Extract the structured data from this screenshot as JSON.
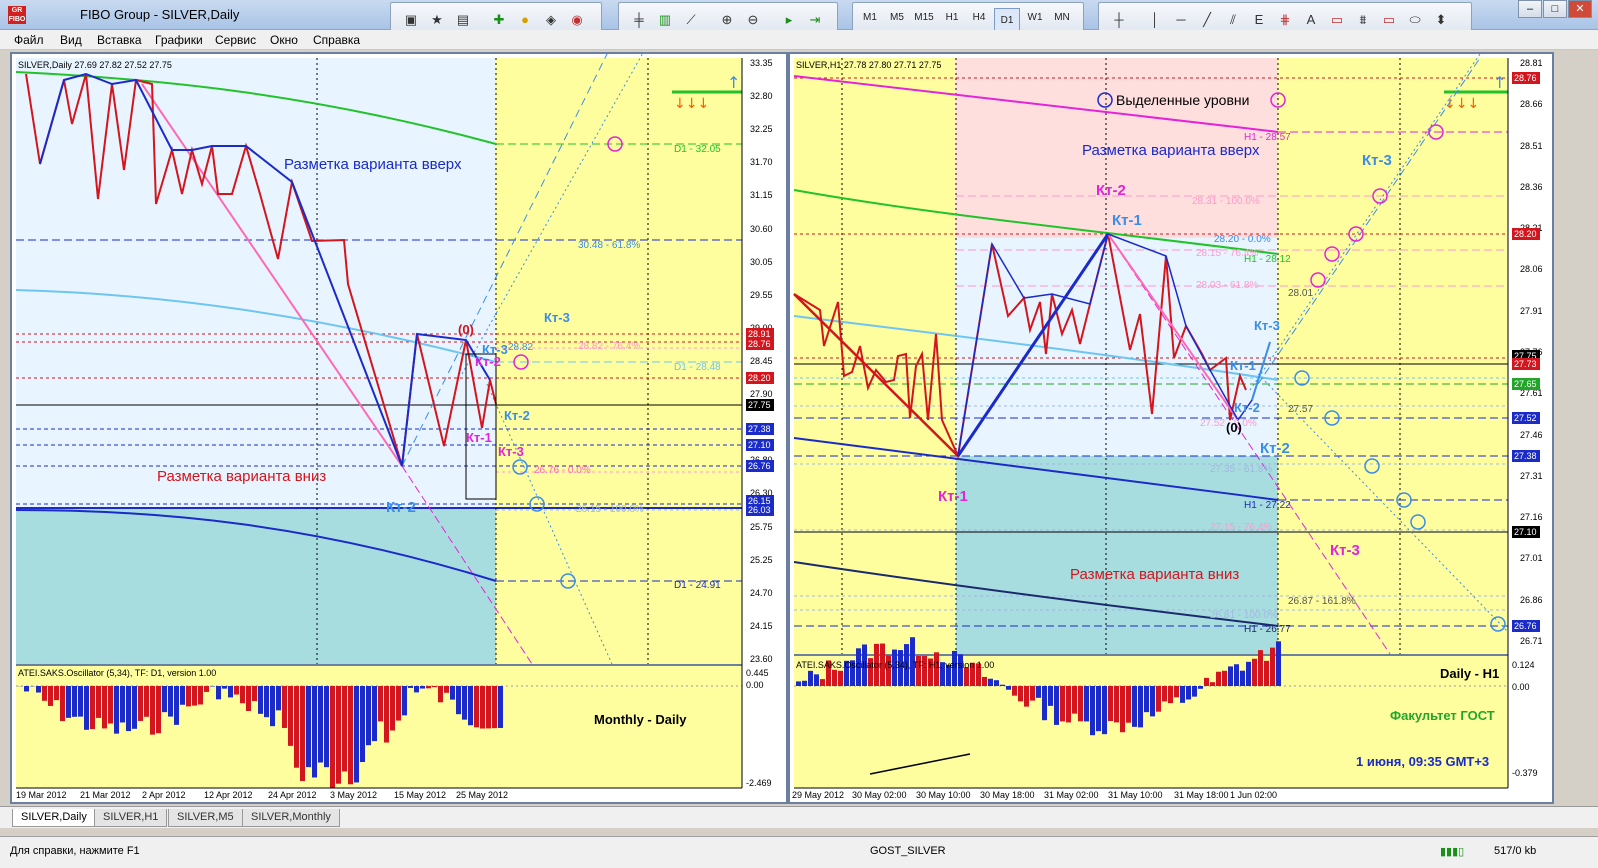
{
  "window": {
    "title": "FIBO Group - SILVER,Daily",
    "logo": "FIBO",
    "logo_top": "GR"
  },
  "menu": [
    "Файл",
    "Вид",
    "Вставка",
    "Графики",
    "Сервис",
    "Окно",
    "Справка"
  ],
  "timeframes": [
    "M1",
    "M5",
    "M15",
    "H1",
    "H4",
    "D1",
    "W1",
    "MN"
  ],
  "selected_timeframe": "D1",
  "colors": {
    "chart_bg": "#fffe9f",
    "pink": "#ff99cc",
    "light_blue": "#e8f4ff",
    "teal": "#a8dde0",
    "blue": "#1a2bc8",
    "red": "#d3151d",
    "green": "#22c32a",
    "magenta": "#e324d8",
    "cyan": "#6ec6f0",
    "hot_pink": "#ff69b4"
  },
  "left": {
    "header": "SILVER,Daily  27.69 27.82 27.52 27.75",
    "price_labels": [
      "33.35",
      "32.80",
      "32.25",
      "31.70",
      "31.15",
      "30.60",
      "30.05",
      "29.55",
      "29.00",
      "28.45",
      "27.90",
      "27.35",
      "26.80",
      "26.30",
      "25.75",
      "25.25",
      "24.70",
      "24.15",
      "23.60"
    ],
    "highlight_prices": [
      {
        "v": "28.91",
        "c": "#d3151d"
      },
      {
        "v": "28.76",
        "c": "#d3151d"
      },
      {
        "v": "28.20",
        "c": "#d3151d"
      },
      {
        "v": "27.75",
        "c": "#000000"
      },
      {
        "v": "27.38",
        "c": "#1a2bc8"
      },
      {
        "v": "27.10",
        "c": "#1a2bc8"
      },
      {
        "v": "26.76",
        "c": "#1a2bc8"
      },
      {
        "v": "26.15",
        "c": "#1a2bc8"
      },
      {
        "v": "26.03",
        "c": "#1a2bc8"
      }
    ],
    "dates": [
      "19 Mar 2012",
      "21 Mar 2012",
      "2 Apr 2012",
      "12 Apr 2012",
      "24 Apr 2012",
      "3 May 2012",
      "15 May 2012",
      "25 May 2012"
    ],
    "texts": {
      "up": "Разметка варианта вверх",
      "down": "Разметка варианта вниз",
      "d1_3205": "D1 - 32.05",
      "f6180": "30.48 - 61.8%",
      "f7640": "28.82 - 76.4%",
      "d1_2848": "D1 - 28.48",
      "f00": "26.76 - 0.0%",
      "f100": "26.15 - 100.0%",
      "d1_2491": "D1 - 24.91",
      "zero": "(0)",
      "kt1": "Кт-1",
      "kt2a": "Кт-2",
      "kt2b": "Кт-2",
      "kt2c": "Кт-2",
      "kt3a": "Кт-3",
      "kt3b": "Кт-3",
      "kt3c": "Кт-3",
      "k2882": "28.82"
    },
    "osc_title": "ATEI.SAKS.Oscillator (5,34), TF: D1, version 1.00",
    "osc_label": "Monthly - Daily",
    "osc_scale": [
      "0.445",
      "0.00",
      "-2.469"
    ]
  },
  "right": {
    "header": "SILVER,H1  27.78 27.80 27.71 27.75",
    "price_labels": [
      "28.81",
      "28.66",
      "28.51",
      "28.36",
      "28.21",
      "28.06",
      "27.91",
      "27.76",
      "27.61",
      "27.46",
      "27.31",
      "27.16",
      "27.01",
      "26.86",
      "26.71"
    ],
    "highlight_prices": [
      {
        "v": "28.76",
        "c": "#d3151d"
      },
      {
        "v": "28.20",
        "c": "#d3151d"
      },
      {
        "v": "27.75",
        "c": "#000000"
      },
      {
        "v": "27.73",
        "c": "#d3151d"
      },
      {
        "v": "27.65",
        "c": "#22a62a"
      },
      {
        "v": "27.52",
        "c": "#1a2bc8"
      },
      {
        "v": "27.38",
        "c": "#1a2bc8"
      },
      {
        "v": "27.10",
        "c": "#000000"
      },
      {
        "v": "26.76",
        "c": "#1a2bc8"
      }
    ],
    "dates": [
      "29 May 2012",
      "30 May 02:00",
      "30 May 10:00",
      "30 May 18:00",
      "31 May 02:00",
      "31 May 10:00",
      "31 May 18:00",
      "1 Jun 02:00"
    ],
    "texts": {
      "levels": "Выделенные уровни",
      "up": "Разметка варианта вверх",
      "down": "Разметка варианта вниз",
      "h1_2857": "H1 - 28.57",
      "f100u": "28.31 - 100.0%",
      "f00u": "28.20 - 0.0%",
      "f76u": "28.15 - 76.4%",
      "h1_2812": "H1 - 28.12",
      "f618u": "28.03 - 61.8%",
      "k2801": "28.01",
      "k2757": "27.57",
      "f2752": "27.52 - 0.0%",
      "f2735": "27.35 - 61.8%",
      "h1_2722": "H1 - 27.22",
      "f2715": "27.15 - 76.4%",
      "f2687": "26.87 - 161.8%",
      "f2681": "26.81 - 100.0%",
      "h1_2677": "H1 - 26.77",
      "kt2m": "Кт-2",
      "kt1b": "Кт-1",
      "kt1m": "Кт-1",
      "kt3c": "Кт-3",
      "kt1c": "Кт-1",
      "kt2c": "Кт-2",
      "kt2b": "Кт-2",
      "kt3b": "Кт-3",
      "kt3m": "Кт-3",
      "zero": "(0)"
    },
    "osc_title": "ATEI.SAKS.Oscillator (5,34), TF: H1, version 1.00",
    "osc_label": "Daily - H1",
    "osc_sub": "Факультет ГОСТ",
    "osc_date": "1 июня, 09:35  GMT+3",
    "osc_scale": [
      "0.124",
      "0.00",
      "-0.379"
    ]
  },
  "tabs": [
    "SILVER,Daily",
    "SILVER,H1",
    "SILVER,M5",
    "SILVER,Monthly"
  ],
  "status": {
    "help": "Для справки, нажмите F1",
    "profile": "GOST_SILVER",
    "traffic": "517/0 kb"
  }
}
